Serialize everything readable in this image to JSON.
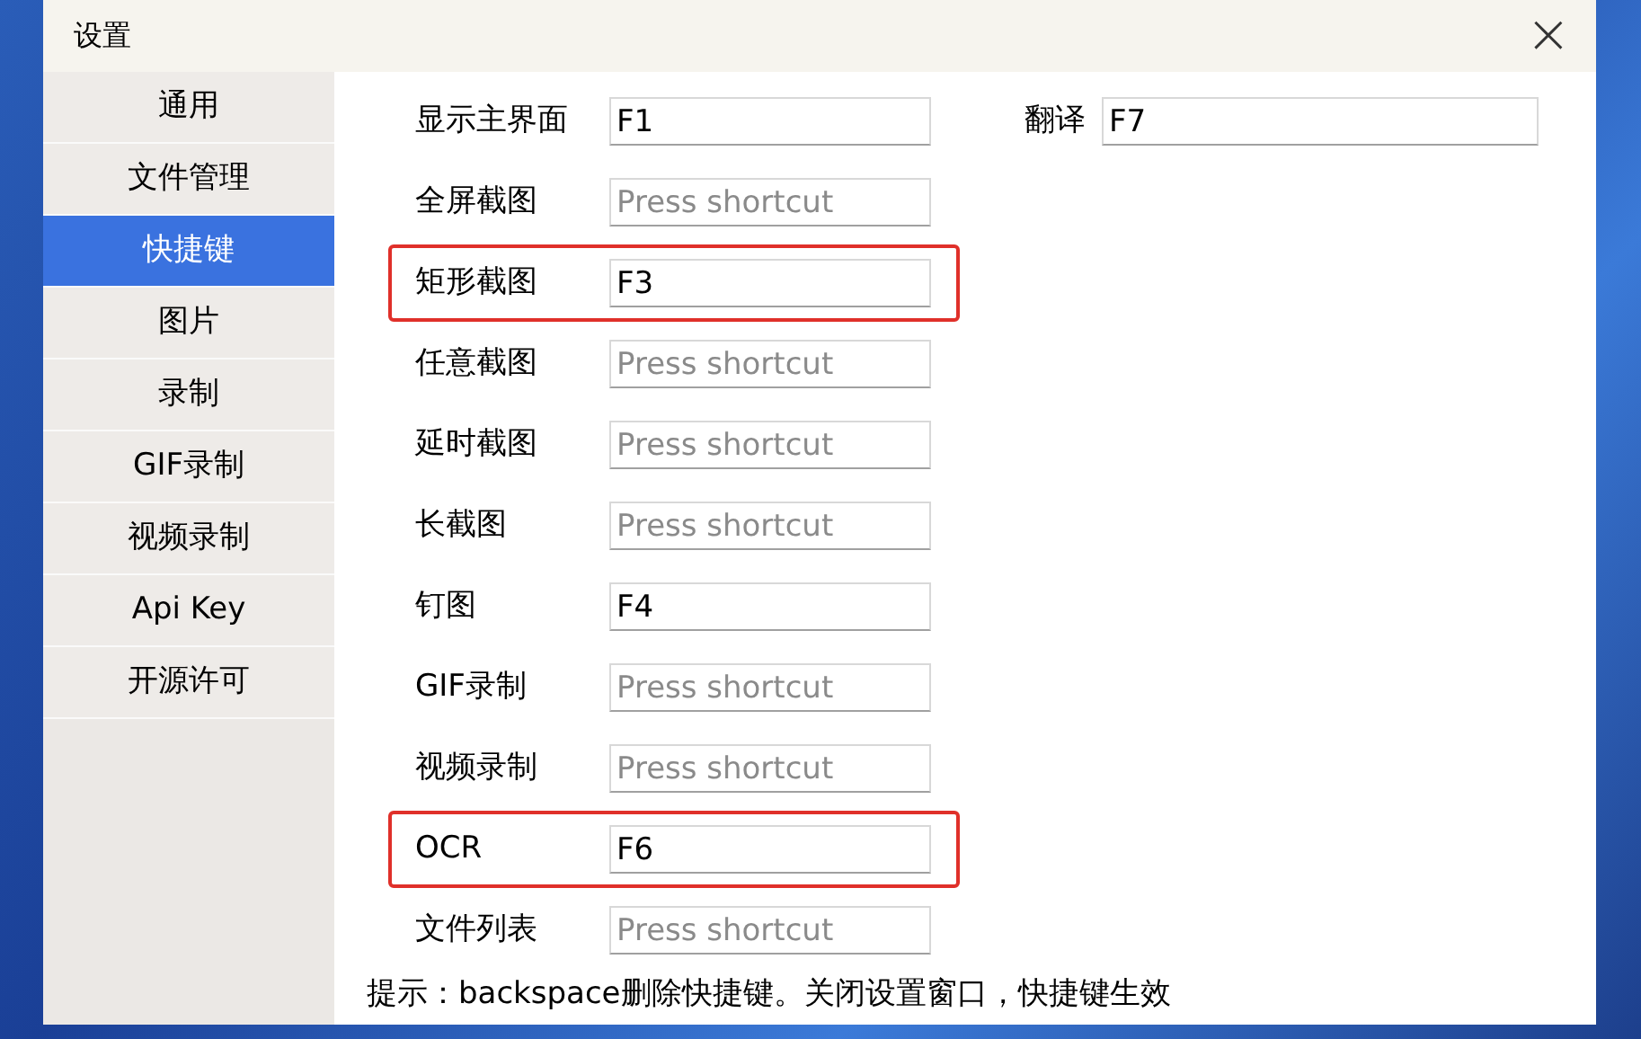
{
  "window": {
    "title": "设置",
    "close": "×"
  },
  "sidebar": {
    "items": [
      {
        "label": "通用",
        "selected": false
      },
      {
        "label": "文件管理",
        "selected": false
      },
      {
        "label": "快捷键",
        "selected": true
      },
      {
        "label": "图片",
        "selected": false
      },
      {
        "label": "录制",
        "selected": false
      },
      {
        "label": "GIF录制",
        "selected": false
      },
      {
        "label": "视频录制",
        "selected": false
      },
      {
        "label": "Api Key",
        "selected": false
      },
      {
        "label": "开源许可",
        "selected": false
      }
    ]
  },
  "shortcuts": [
    {
      "label": "显示主界面",
      "value": "F1",
      "highlighted": false
    },
    {
      "label": "全屏截图",
      "placeholder": "Press shortcut",
      "highlighted": false
    },
    {
      "label": "矩形截图",
      "value": "F3",
      "highlighted": true
    },
    {
      "label": "任意截图",
      "placeholder": "Press shortcut",
      "highlighted": false
    },
    {
      "label": "延时截图",
      "placeholder": "Press shortcut",
      "highlighted": false
    },
    {
      "label": "长截图",
      "placeholder": "Press shortcut",
      "highlighted": false
    },
    {
      "label": "钉图",
      "value": "F4",
      "highlighted": false
    },
    {
      "label": "GIF录制",
      "placeholder": "Press shortcut",
      "highlighted": false
    },
    {
      "label": "视频录制",
      "placeholder": "Press shortcut",
      "highlighted": false
    },
    {
      "label": "OCR",
      "value": "F6",
      "highlighted": true
    },
    {
      "label": "文件列表",
      "placeholder": "Press shortcut",
      "highlighted": false
    }
  ],
  "translate_shortcut": {
    "label": "翻译",
    "value": "F7"
  },
  "hint": "提示：backspace删除快捷键。关闭设置窗口，快捷键生效"
}
